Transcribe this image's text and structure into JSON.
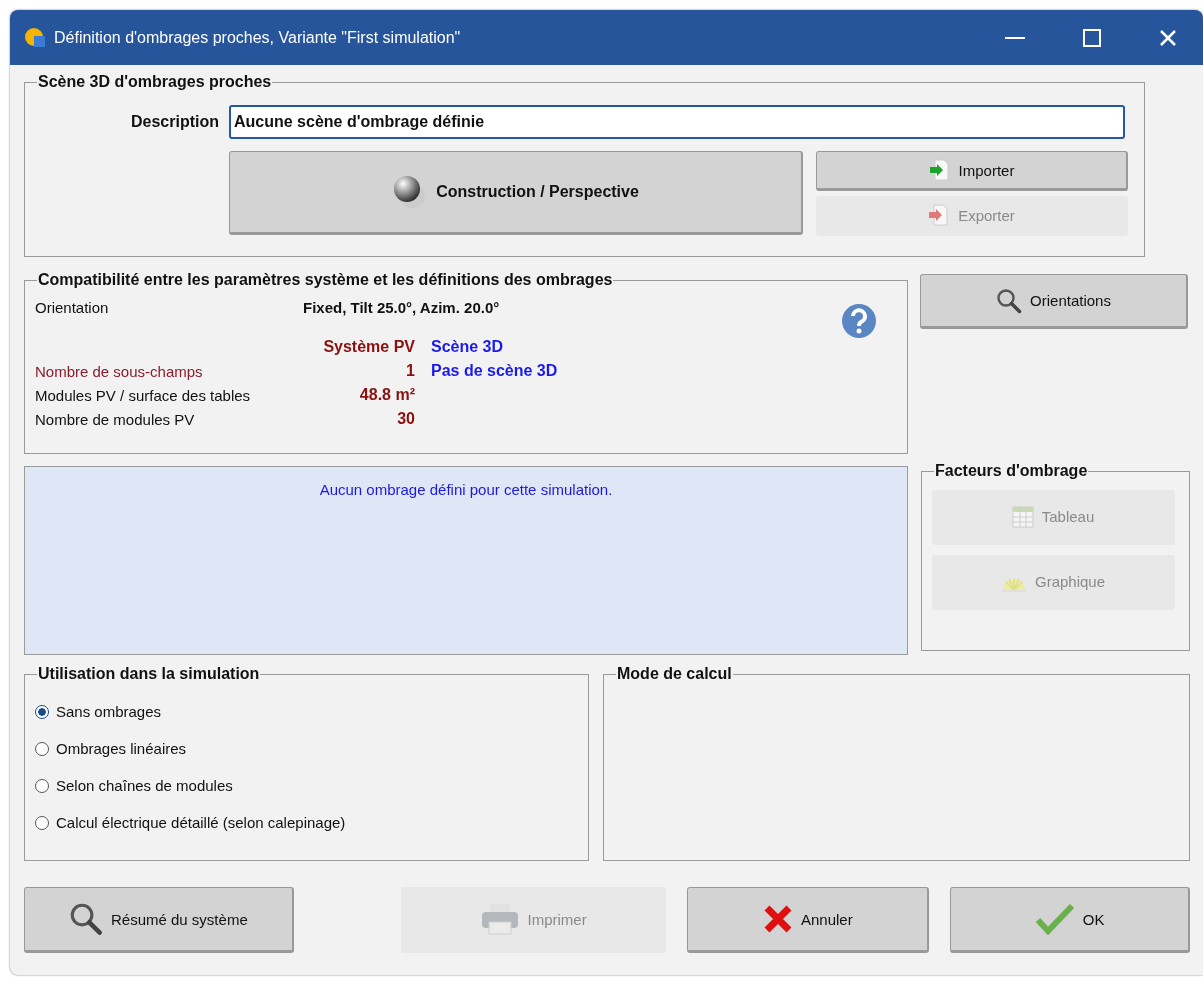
{
  "window": {
    "title": "Définition d'ombrages proches, Variante \"First simulation\""
  },
  "scene": {
    "title": "Scène 3D d'ombrages proches",
    "description_label": "Description",
    "description": "Aucune scène d'ombrage définie",
    "construction_button": {
      "label": "Construction / Perspective",
      "disabled": false
    },
    "import_button": {
      "label": "Importer",
      "disabled": false
    },
    "export_button": {
      "label": "Exporter",
      "disabled": true
    }
  },
  "compatibility": {
    "title": "Compatibilité entre les paramètres système et les définitions des ombrages",
    "orientation_label": "Orientation",
    "orientation_value": "Fixed, Tilt 25.0°, Azim. 20.0°",
    "pv_header": "Système PV",
    "scene_header": "Scène 3D",
    "rows": [
      {
        "label": "Nombre de sous-champs",
        "pv": "1",
        "scene": "Pas de scène 3D",
        "mismatch": true
      },
      {
        "label": "Modules PV / surface des tables",
        "pv": "48.8 m²",
        "mismatch": false
      },
      {
        "label": "Nombre de modules PV",
        "pv": "30",
        "mismatch": false
      }
    ]
  },
  "orientations_button": {
    "label": "Orientations",
    "disabled": false
  },
  "message": "Aucun ombrage défini pour cette simulation.",
  "shading_factors": {
    "title": "Facteurs d'ombrage",
    "buttons": [
      {
        "label": "Tableau",
        "kind": "table",
        "disabled": true
      },
      {
        "label": "Graphique",
        "kind": "chart",
        "disabled": true
      }
    ]
  },
  "usage": {
    "title": "Utilisation dans la simulation",
    "options": [
      {
        "label": "Sans ombrages",
        "selected": true
      },
      {
        "label": "Ombrages linéaires",
        "selected": false
      },
      {
        "label": "Selon chaînes de modules",
        "selected": false
      },
      {
        "label": "Calcul électrique détaillé (selon calepinage)",
        "selected": false
      }
    ]
  },
  "calc_mode": {
    "title": "Mode de calcul"
  },
  "footer_buttons": [
    {
      "label": "Résumé du système",
      "kind": "summary",
      "disabled": false
    },
    {
      "label": "Imprimer",
      "kind": "print",
      "disabled": true
    },
    {
      "label": "Annuler",
      "kind": "cancel",
      "disabled": false
    },
    {
      "label": "OK",
      "kind": "ok",
      "disabled": false
    }
  ]
}
